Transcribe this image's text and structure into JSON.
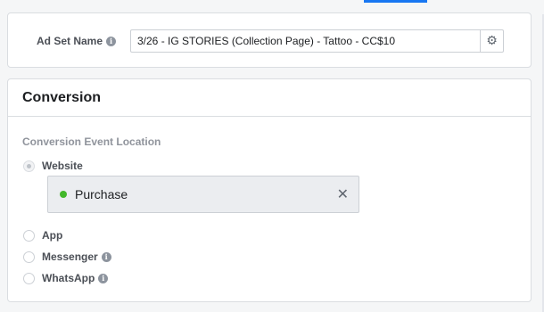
{
  "ad_set": {
    "label": "Ad Set Name",
    "name_value": "3/26 - IG STORIES (Collection Page) - Tattoo - CC$10",
    "info_icon": "i",
    "gear_icon": "⚙"
  },
  "conversion": {
    "title": "Conversion",
    "location_label": "Conversion Event Location",
    "options": [
      {
        "label": "Website",
        "selected": true
      },
      {
        "label": "App",
        "selected": false
      },
      {
        "label": "Messenger",
        "selected": false,
        "info_icon": "i"
      },
      {
        "label": "WhatsApp",
        "selected": false,
        "info_icon": "i"
      }
    ],
    "event": {
      "label": "Purchase",
      "status_color": "#42b72a",
      "remove_glyph": "✕"
    }
  },
  "colors": {
    "accent": "#1877f2",
    "status_active": "#42b72a"
  }
}
